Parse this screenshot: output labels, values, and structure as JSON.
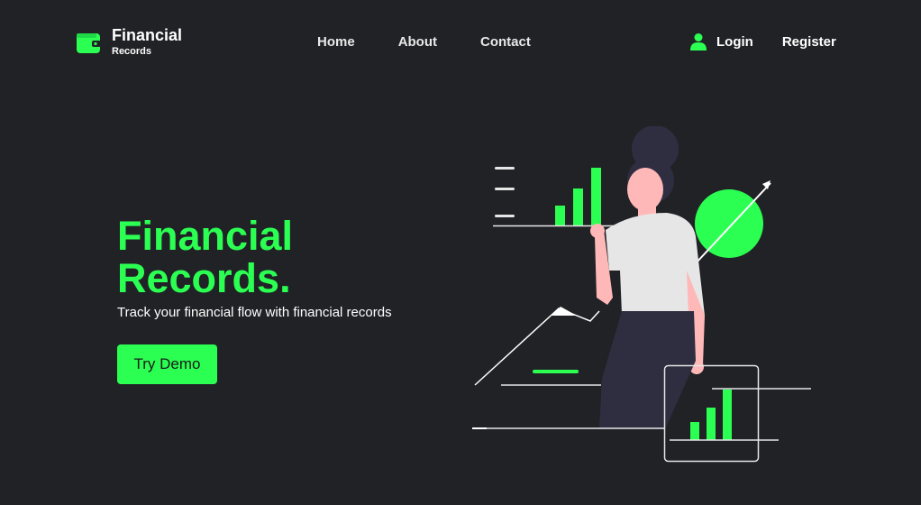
{
  "header": {
    "logo_title": "Financial",
    "logo_subtitle": "Records",
    "logo_icon": "wallet-icon",
    "nav": [
      {
        "label": "Home"
      },
      {
        "label": "About"
      },
      {
        "label": "Contact"
      }
    ],
    "login_icon": "user-icon",
    "login_label": "Login",
    "register_label": "Register"
  },
  "hero": {
    "title_line1": "Financial",
    "title_line2": "Records.",
    "subtitle": "Track your financial flow with financial records",
    "cta_label": "Try Demo"
  },
  "colors": {
    "accent": "#2bff52",
    "background": "#212226",
    "text": "#ffffff"
  }
}
